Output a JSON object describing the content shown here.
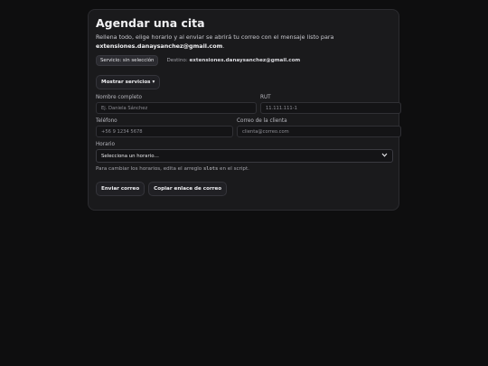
{
  "title": "Agendar una cita",
  "description": {
    "text": "Rellena todo, elige horario y al enviar se abrirá tu correo con el mensaje listo para",
    "email": "extensiones.danaysanchez@gmail.com",
    "end": "."
  },
  "service_badge": "Servicio: sin selección",
  "destination": {
    "label": "Destino:",
    "email": "extensiones.danaysanchez@gmail.com"
  },
  "show_services_button": "Mostrar servicios ▾",
  "fields": {
    "name": {
      "label": "Nombre completo",
      "placeholder": "Ej. Daniela Sánchez"
    },
    "rut": {
      "label": "RUT",
      "placeholder": "11.111.111-1"
    },
    "phone": {
      "label": "Teléfono",
      "placeholder": "+56 9 1234 5678"
    },
    "email": {
      "label": "Correo de la clienta",
      "placeholder": "clienta@correo.com"
    },
    "schedule": {
      "label": "Horario",
      "selected": "Selecciona un horario…"
    }
  },
  "hint": {
    "before": "Para cambiar los horarios, edita el arreglo",
    "code": "slots",
    "after": "en el script."
  },
  "buttons": {
    "send": "Enviar correo",
    "copy_link": "Copiar enlace de correo"
  },
  "icons": {
    "select_chevron": "chevron-down-icon"
  },
  "colors": {
    "background": "#0e0e0f",
    "card": "#1a1a1c",
    "border": "#2c2c30"
  }
}
